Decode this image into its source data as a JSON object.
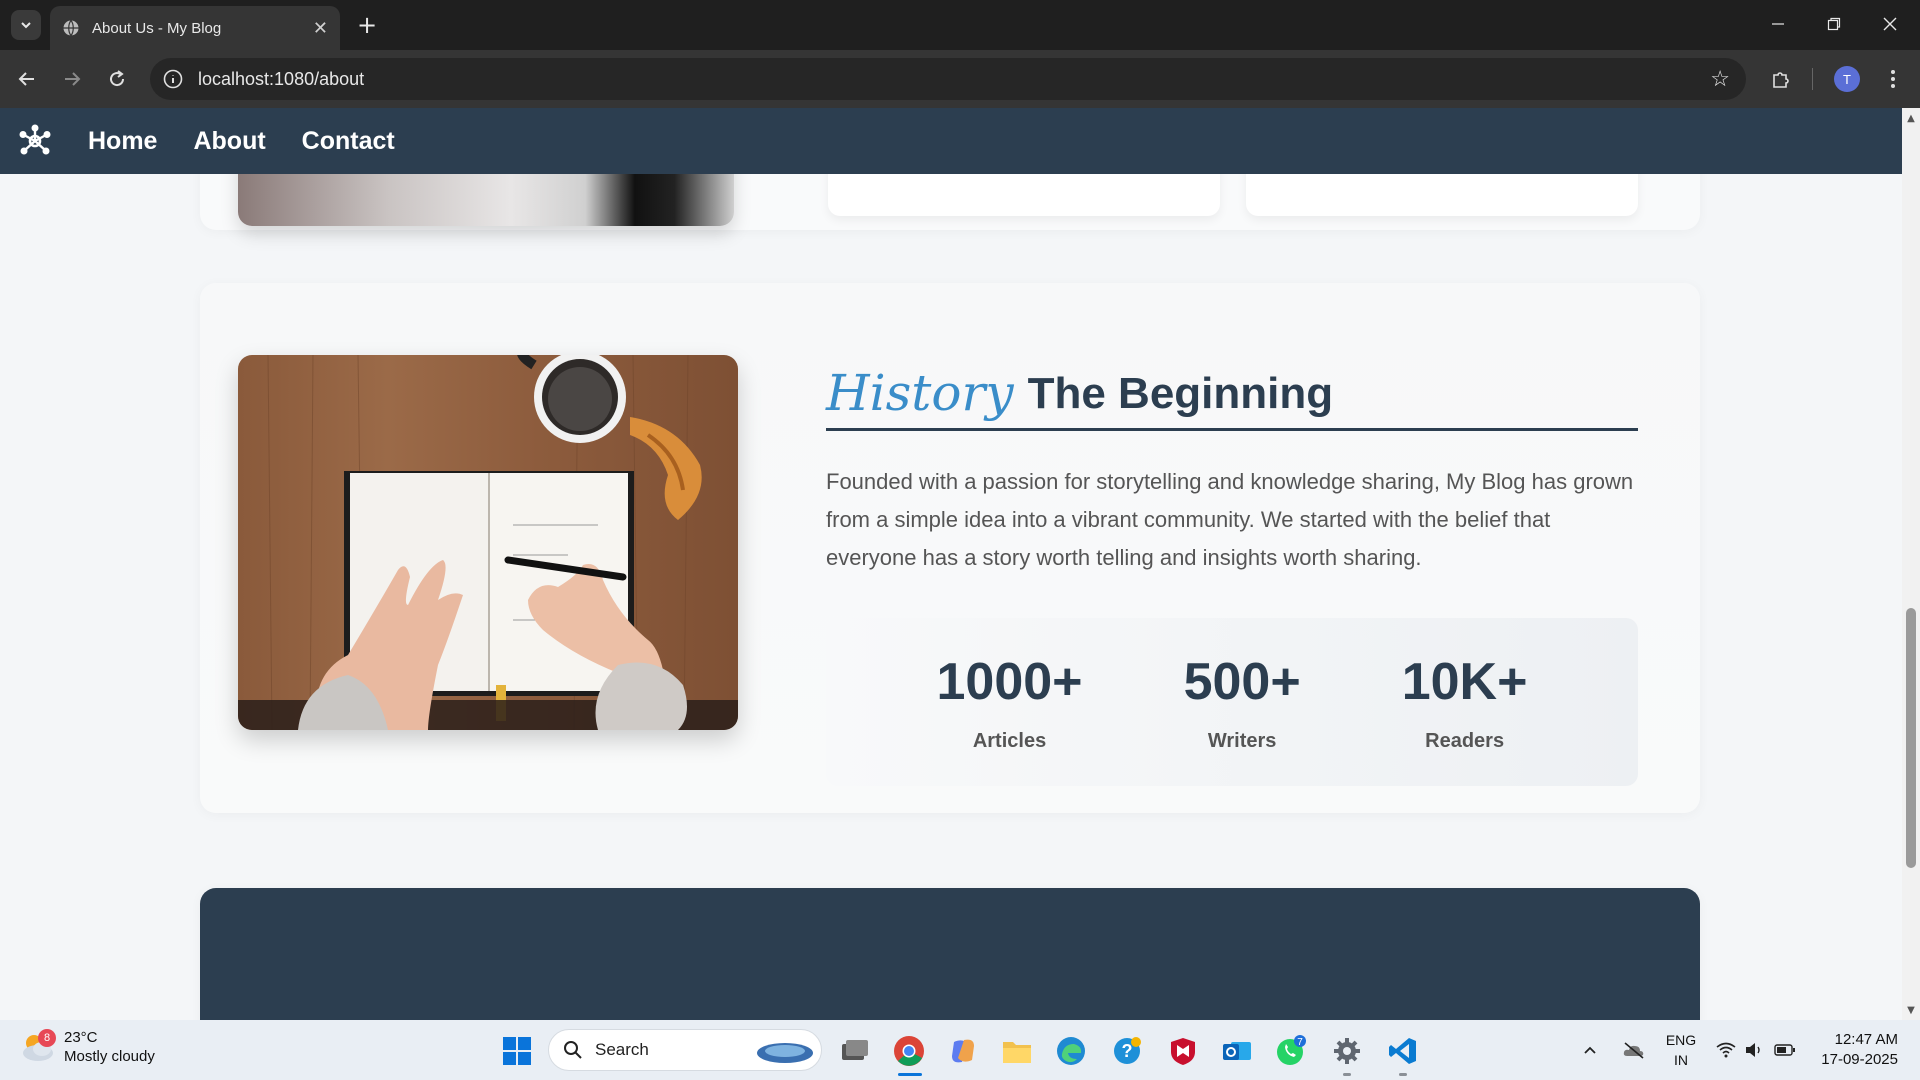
{
  "browser": {
    "tab_title": "About Us - My Blog",
    "url": "localhost:1080/about",
    "profile_initial": "T"
  },
  "site_nav": {
    "items": [
      {
        "label": "Home"
      },
      {
        "label": "About"
      },
      {
        "label": "Contact"
      }
    ]
  },
  "history": {
    "script_word": "History",
    "title": "The Beginning",
    "paragraph": "Founded with a passion for storytelling and knowledge sharing, My Blog has grown from a simple idea into a vibrant community. We started with the belief that everyone has a story worth telling and insights worth sharing.",
    "stats": [
      {
        "value": "1000+",
        "label": "Articles"
      },
      {
        "value": "500+",
        "label": "Writers"
      },
      {
        "value": "10K+",
        "label": "Readers"
      }
    ]
  },
  "taskbar": {
    "weather_temp": "23°C",
    "weather_desc": "Mostly cloudy",
    "weather_badge": "8",
    "search_label": "Search",
    "whatsapp_badge": "7",
    "lang_line1": "ENG",
    "lang_line2": "IN",
    "time": "12:47 AM",
    "date": "17-09-2025"
  },
  "colors": {
    "nav_bg": "#2c3e50",
    "accent_script": "#3a8dc9",
    "heading": "#2c3e50"
  }
}
